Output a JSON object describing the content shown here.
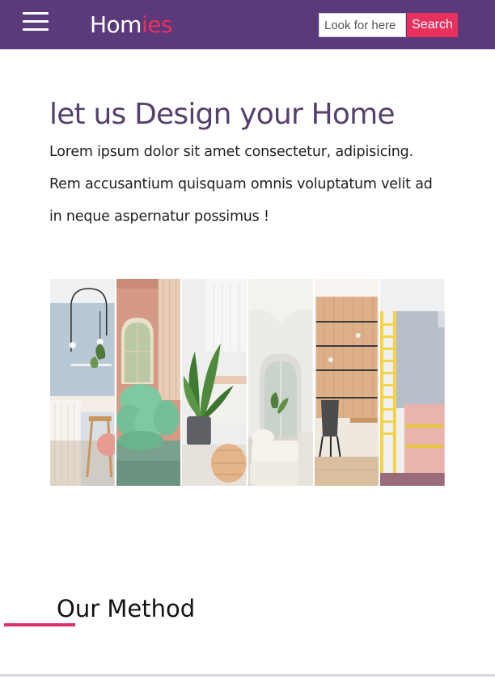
{
  "header": {
    "menu_icon": "hamburger-menu-icon",
    "logo_main": "Hom",
    "logo_accent": "ies",
    "search_placeholder": "Look for here",
    "search_button": "Search",
    "colors": {
      "background": "#5a3a7a",
      "accent": "#e8305f"
    }
  },
  "hero": {
    "title": "let us Design your Home",
    "text": "Lorem ipsum dolor sit amet consectetur, adipisicing. Rem accusantium quisquam omnis voluptatum velit ad in neque aspernatur possimus !"
  },
  "gallery": {
    "panels": [
      "interior-photo",
      "interior-photo",
      "interior-photo",
      "interior-photo",
      "interior-photo",
      "interior-photo"
    ]
  },
  "method": {
    "title": "Our Method",
    "underline_color": "#e0306a"
  }
}
